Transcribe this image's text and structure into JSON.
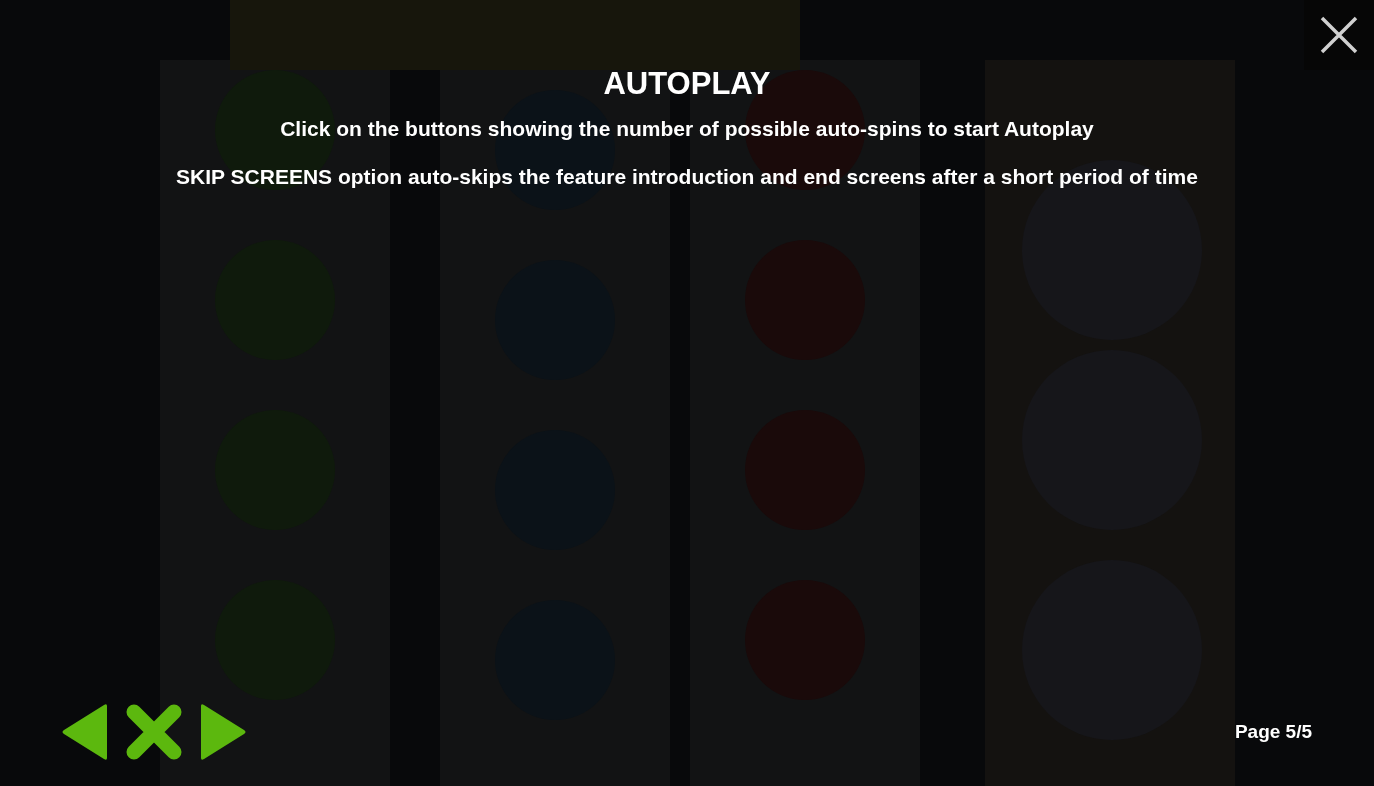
{
  "title": "AUTOPLAY",
  "paragraphs": [
    "Click on the buttons showing the number of possible auto-spins to start Autoplay",
    "SKIP SCREENS option auto-skips the feature introduction and end screens after a short period of time"
  ],
  "page_label": "Page 5/5"
}
